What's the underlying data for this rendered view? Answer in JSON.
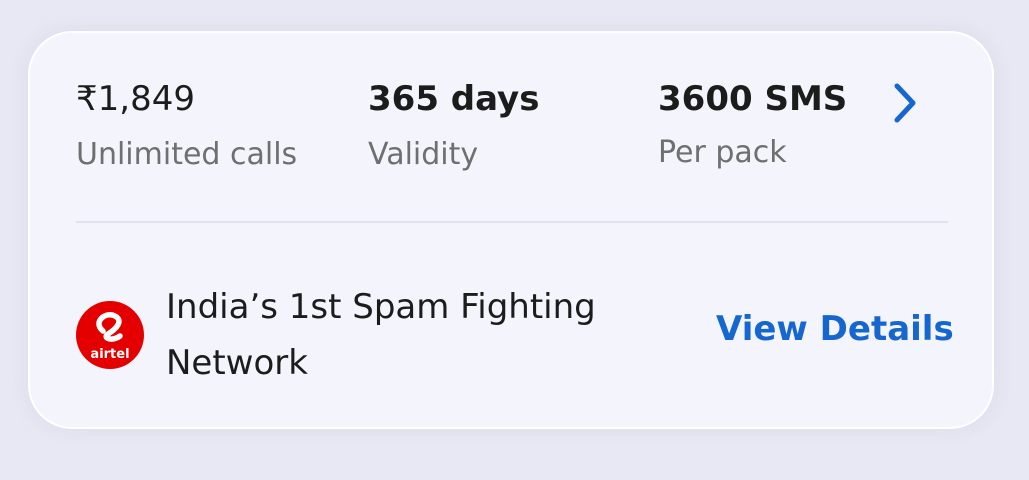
{
  "plan": {
    "price": "₹1,849",
    "price_label": "Unlimited calls",
    "validity": "365 days",
    "validity_label": "Validity",
    "sms": "3600 SMS",
    "sms_label": "Per pack"
  },
  "network": {
    "logo_text": "airtel",
    "tagline": "India’s 1st Spam Fighting Network",
    "details_link": "View Details"
  },
  "icons": {
    "chevron": "chevron-right-icon",
    "logo": "airtel-logo"
  },
  "colors": {
    "accent": "#1666d0",
    "brand": "#e40000",
    "card_bg": "#f4f4fc",
    "page_bg": "#e8e8f4"
  }
}
